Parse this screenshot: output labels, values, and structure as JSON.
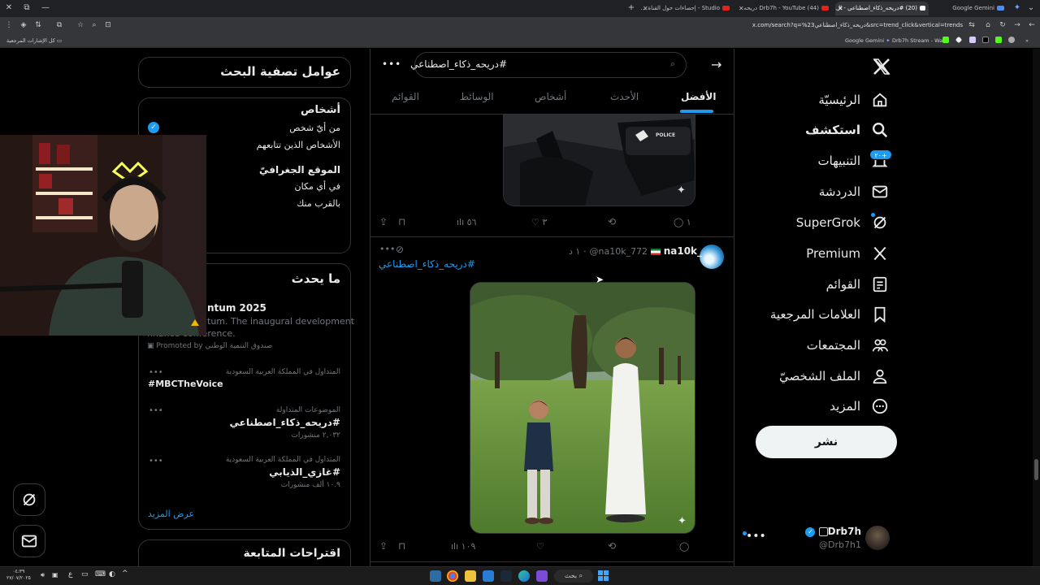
{
  "browser": {
    "tabs": [
      {
        "label": "Google Gemini",
        "active": false
      },
      {
        "label": "(20) #دريحه_ذكاء_اصطناعي - ال...",
        "active": true
      },
      {
        "label": "Drb7h - YouTube (44) دريحه",
        "active": false
      },
      {
        "label": "Studio - إحصاءات حول القناة ...",
        "active": false
      }
    ],
    "url": "x.com/search?q=%23دريحه_ذكاء_اصطناعي&src=trend_click&vertical=trends",
    "bookmarks": {
      "left": "كل الإشارات المرجعية",
      "gemini": "Google Gemini",
      "stream": "Drb7h Stream - Wat..."
    }
  },
  "nav": {
    "items": [
      {
        "label": "الرئيسيّة",
        "icon": "home-icon"
      },
      {
        "label": "استكشف",
        "icon": "search-icon"
      },
      {
        "label": "التنبيهات",
        "icon": "bell-icon"
      },
      {
        "label": "الدردشة",
        "icon": "mail-icon"
      },
      {
        "label": "SuperGrok",
        "icon": "grok-icon"
      },
      {
        "label": "Premium",
        "icon": "x-logo-icon"
      },
      {
        "label": "القوائم",
        "icon": "list-icon"
      },
      {
        "label": "العلامات المرجعية",
        "icon": "bookmark-icon"
      },
      {
        "label": "المجتمعات",
        "icon": "communities-icon"
      },
      {
        "label": "الملف الشخصيّ",
        "icon": "profile-icon"
      },
      {
        "label": "المزيد",
        "icon": "more-circle-icon"
      }
    ],
    "notif_badge": "٢٠+",
    "post_label": "نشر",
    "account": {
      "name": "Drb7h",
      "handle": "@Drb7h1"
    }
  },
  "search": {
    "query": "#دريحه_ذكاء_اصطناعي",
    "tabs": [
      "الأفضل",
      "الأحدث",
      "أشخاص",
      "الوسائط",
      "القوائم"
    ]
  },
  "posts": [
    {
      "image": "police-scene",
      "badge": "POLICE",
      "actions": {
        "reply": "١",
        "repost": "",
        "like": "٣",
        "views": "٥٦"
      }
    },
    {
      "author": "na10k_",
      "handle": "@na10k_772",
      "time": "١ د",
      "hashtag": "#دريحه_ذكاء_اصطناعي",
      "image": "two-boys-park",
      "actions": {
        "reply": "",
        "repost": "",
        "like": "",
        "views": "١٠٩"
      }
    }
  ],
  "filters": {
    "title": "عوامل تصفية البحث",
    "people_heading": "أشخاص",
    "people_options": [
      "من أيّ شخص",
      "الأشخاص الذين تتابعهم"
    ],
    "location_heading": "الموقع الجغرافيّ",
    "location_options": [
      "في أي مكان",
      "بالقرب منك"
    ]
  },
  "trends": {
    "title": "ما يحدث",
    "promo_title": "ntum 2025",
    "promo_desc": "tum. The inaugural development",
    "promo_desc2": "finance conference.",
    "promoted_by": "Promoted by",
    "promoted_sponsor": "صندوق التنمية الوطني",
    "items": [
      {
        "context": "المتداول في المملكة العربية السعودية",
        "name": "#MBCTheVoice",
        "count": ""
      },
      {
        "context": "الموضوعات المتداولة",
        "name": "#دريحه_ذكاء_اصطناعي",
        "count": "٢,٠٣٢ منشورات"
      },
      {
        "context": "المتداول في المملكة العربية السعودية",
        "name": "#غازي_الذيابي",
        "count": "١٠.٩ ألف منشورات"
      }
    ],
    "show_more": "عرض المزيد"
  },
  "suggestions": {
    "title": "اقتراحات المتابعة"
  },
  "taskbar": {
    "search_label": "بحث",
    "time": "٠٤:٣٩",
    "date": "٢٧/٠٧/٢٠٢٥",
    "lang": "ع"
  },
  "colors": {
    "accent": "#1d9bf0",
    "background": "#000000",
    "text": "#e7e9ea",
    "muted": "#71767b"
  }
}
